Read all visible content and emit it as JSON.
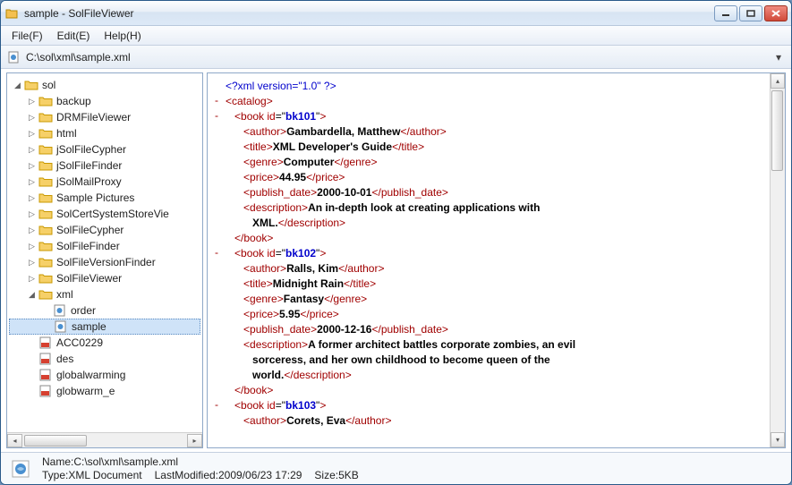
{
  "titlebar": {
    "title": "sample - SolFileViewer"
  },
  "menubar": {
    "file": "File(F)",
    "edit": "Edit(E)",
    "help": "Help(H)"
  },
  "addressbar": {
    "path": "C:\\sol\\xml\\sample.xml"
  },
  "tree": {
    "items": [
      {
        "label": "sol",
        "type": "folder",
        "depth": 0,
        "expander": "open"
      },
      {
        "label": "backup",
        "type": "folder",
        "depth": 1,
        "expander": "closed"
      },
      {
        "label": "DRMFileViewer",
        "type": "folder",
        "depth": 1,
        "expander": "closed"
      },
      {
        "label": "html",
        "type": "folder",
        "depth": 1,
        "expander": "closed"
      },
      {
        "label": "jSolFileCypher",
        "type": "folder",
        "depth": 1,
        "expander": "closed"
      },
      {
        "label": "jSolFileFinder",
        "type": "folder",
        "depth": 1,
        "expander": "closed"
      },
      {
        "label": "jSolMailProxy",
        "type": "folder",
        "depth": 1,
        "expander": "closed"
      },
      {
        "label": "Sample Pictures",
        "type": "folder",
        "depth": 1,
        "expander": "closed"
      },
      {
        "label": "SolCertSystemStoreVie",
        "type": "folder",
        "depth": 1,
        "expander": "closed"
      },
      {
        "label": "SolFileCypher",
        "type": "folder",
        "depth": 1,
        "expander": "closed"
      },
      {
        "label": "SolFileFinder",
        "type": "folder",
        "depth": 1,
        "expander": "closed"
      },
      {
        "label": "SolFileVersionFinder",
        "type": "folder",
        "depth": 1,
        "expander": "closed"
      },
      {
        "label": "SolFileViewer",
        "type": "folder",
        "depth": 1,
        "expander": "closed"
      },
      {
        "label": "xml",
        "type": "folder",
        "depth": 1,
        "expander": "open"
      },
      {
        "label": "order",
        "type": "xmlfile",
        "depth": 2,
        "expander": "none"
      },
      {
        "label": "sample",
        "type": "xmlfile",
        "depth": 2,
        "expander": "none",
        "selected": true
      },
      {
        "label": "ACC0229",
        "type": "pdf",
        "depth": 1,
        "expander": "none"
      },
      {
        "label": "des",
        "type": "pdf",
        "depth": 1,
        "expander": "none"
      },
      {
        "label": "globalwarming",
        "type": "pdf",
        "depth": 1,
        "expander": "none"
      },
      {
        "label": "globwarm_e",
        "type": "pdf",
        "depth": 1,
        "expander": "none"
      }
    ]
  },
  "xml": {
    "lines": [
      {
        "depth": 0,
        "marker": "",
        "html": "<span class='pi'>&lt;?xml version=\"1.0\" ?&gt;</span>"
      },
      {
        "depth": 0,
        "marker": "-",
        "html": "<span class='tag'>&lt;catalog&gt;</span>"
      },
      {
        "depth": 1,
        "marker": "-",
        "html": "<span class='tag'>&lt;book</span> <span class='attrn'>id</span>=\"<span class='attrv'>bk101</span>\"<span class='tag'>&gt;</span>"
      },
      {
        "depth": 2,
        "marker": "",
        "html": "<span class='tag'>&lt;author&gt;</span><span class='txt'>Gambardella, Matthew</span><span class='tag'>&lt;/author&gt;</span>"
      },
      {
        "depth": 2,
        "marker": "",
        "html": "<span class='tag'>&lt;title&gt;</span><span class='txt'>XML Developer's Guide</span><span class='tag'>&lt;/title&gt;</span>"
      },
      {
        "depth": 2,
        "marker": "",
        "html": "<span class='tag'>&lt;genre&gt;</span><span class='txt'>Computer</span><span class='tag'>&lt;/genre&gt;</span>"
      },
      {
        "depth": 2,
        "marker": "",
        "html": "<span class='tag'>&lt;price&gt;</span><span class='txt'>44.95</span><span class='tag'>&lt;/price&gt;</span>"
      },
      {
        "depth": 2,
        "marker": "",
        "html": "<span class='tag'>&lt;publish_date&gt;</span><span class='txt'>2000-10-01</span><span class='tag'>&lt;/publish_date&gt;</span>"
      },
      {
        "depth": 2,
        "marker": "",
        "html": "<span class='tag'>&lt;description&gt;</span><span class='txt'>An in-depth look at creating applications with</span>"
      },
      {
        "depth": 3,
        "marker": "",
        "html": "<span class='txt'>XML.</span><span class='tag'>&lt;/description&gt;</span>"
      },
      {
        "depth": 1,
        "marker": "",
        "html": "<span class='tag'>&lt;/book&gt;</span>"
      },
      {
        "depth": 1,
        "marker": "-",
        "html": "<span class='tag'>&lt;book</span> <span class='attrn'>id</span>=\"<span class='attrv'>bk102</span>\"<span class='tag'>&gt;</span>"
      },
      {
        "depth": 2,
        "marker": "",
        "html": "<span class='tag'>&lt;author&gt;</span><span class='txt'>Ralls, Kim</span><span class='tag'>&lt;/author&gt;</span>"
      },
      {
        "depth": 2,
        "marker": "",
        "html": "<span class='tag'>&lt;title&gt;</span><span class='txt'>Midnight Rain</span><span class='tag'>&lt;/title&gt;</span>"
      },
      {
        "depth": 2,
        "marker": "",
        "html": "<span class='tag'>&lt;genre&gt;</span><span class='txt'>Fantasy</span><span class='tag'>&lt;/genre&gt;</span>"
      },
      {
        "depth": 2,
        "marker": "",
        "html": "<span class='tag'>&lt;price&gt;</span><span class='txt'>5.95</span><span class='tag'>&lt;/price&gt;</span>"
      },
      {
        "depth": 2,
        "marker": "",
        "html": "<span class='tag'>&lt;publish_date&gt;</span><span class='txt'>2000-12-16</span><span class='tag'>&lt;/publish_date&gt;</span>"
      },
      {
        "depth": 2,
        "marker": "",
        "html": "<span class='tag'>&lt;description&gt;</span><span class='txt'>A former architect battles corporate zombies, an evil</span>"
      },
      {
        "depth": 3,
        "marker": "",
        "html": "<span class='txt'>sorceress, and her own childhood to become queen of the</span>"
      },
      {
        "depth": 3,
        "marker": "",
        "html": "<span class='txt'>world.</span><span class='tag'>&lt;/description&gt;</span>"
      },
      {
        "depth": 1,
        "marker": "",
        "html": "<span class='tag'>&lt;/book&gt;</span>"
      },
      {
        "depth": 1,
        "marker": "-",
        "html": "<span class='tag'>&lt;book</span> <span class='attrn'>id</span>=\"<span class='attrv'>bk103</span>\"<span class='tag'>&gt;</span>"
      },
      {
        "depth": 2,
        "marker": "",
        "html": "<span class='tag'>&lt;author&gt;</span><span class='txt'>Corets, Eva</span><span class='tag'>&lt;/author&gt;</span>"
      }
    ]
  },
  "status": {
    "name_label": "Name:",
    "name_value": "C:\\sol\\xml\\sample.xml",
    "type_label": "Type:",
    "type_value": "XML Document",
    "lastmod_label": "LastModified:",
    "lastmod_value": "2009/06/23 17:29",
    "size_label": "Size:",
    "size_value": "5KB"
  }
}
